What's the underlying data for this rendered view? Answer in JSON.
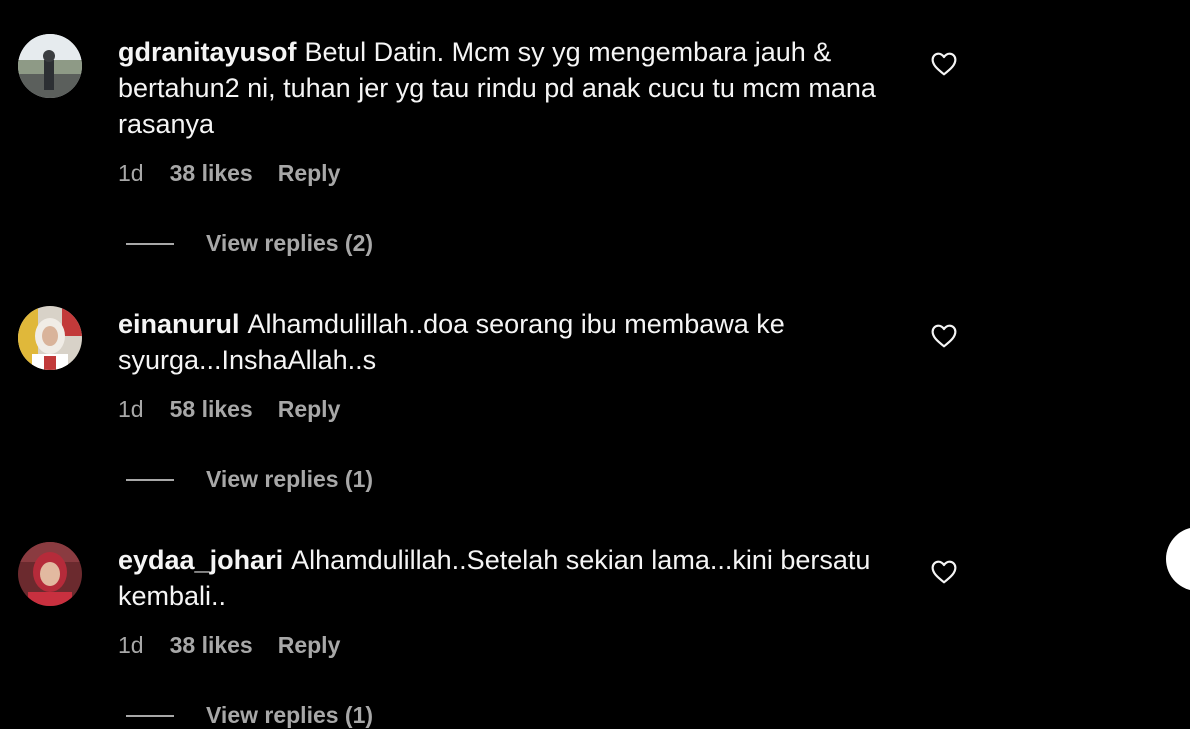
{
  "comments": [
    {
      "username": "gdranitayusof",
      "text": "Betul Datin. Mcm sy yg mengembara jauh & bertahun2 ni, tuhan jer yg tau rindu pd anak cucu tu mcm mana rasanya",
      "age": "1d",
      "likes": "38 likes",
      "reply_label": "Reply",
      "view_replies": "View replies (2)"
    },
    {
      "username": "einanurul",
      "text": "Alhamdulillah..doa seorang ibu membawa ke syurga...InshaAllah..s",
      "age": "1d",
      "likes": "58 likes",
      "reply_label": "Reply",
      "view_replies": "View replies (1)"
    },
    {
      "username": "eydaa_johari",
      "text": "Alhamdulillah..Setelah sekian lama...kini bersatu kembali..",
      "age": "1d",
      "likes": "38 likes",
      "reply_label": "Reply",
      "view_replies": "View replies (1)"
    }
  ],
  "icons": {
    "like": "heart-outline-icon"
  },
  "colors": {
    "background": "#000000",
    "primary_text": "#f5f5f5",
    "secondary_text": "#a8a8a8"
  }
}
